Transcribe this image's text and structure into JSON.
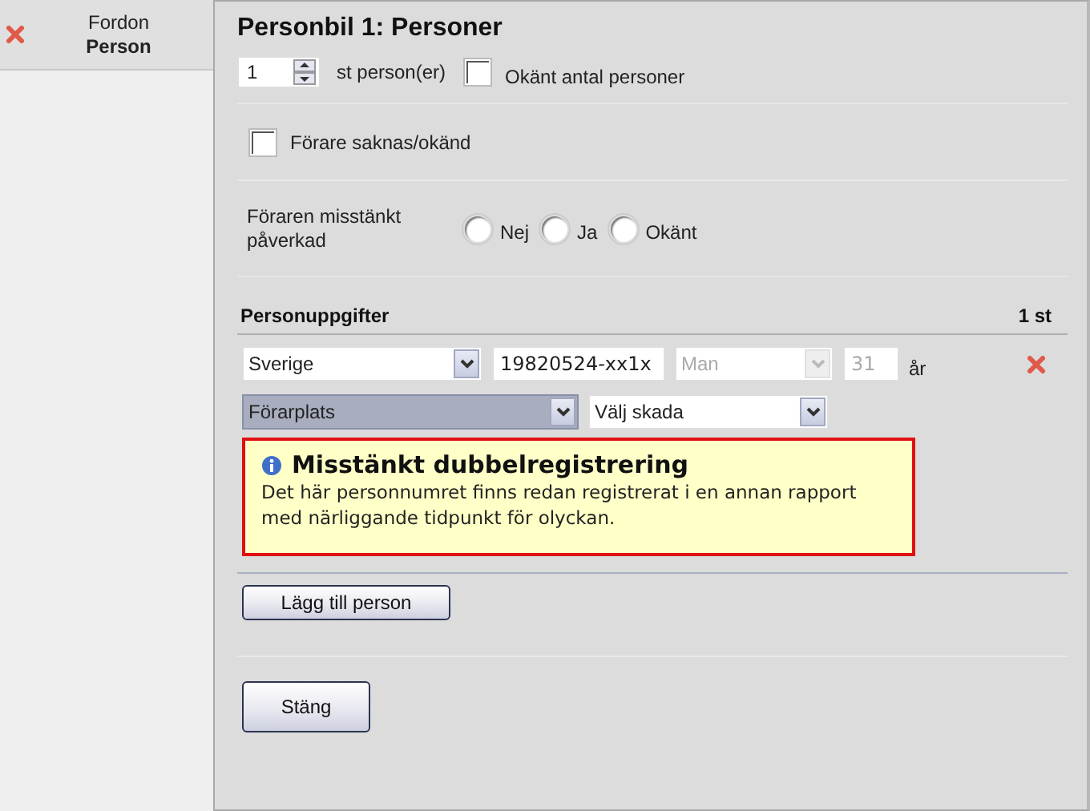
{
  "sidebar": {
    "items": [
      {
        "title": "Fordon",
        "subtitle": "Person",
        "selected": true
      }
    ]
  },
  "title": "Personbil 1: Personer",
  "count": {
    "value": "1",
    "unit": "st person(er)",
    "unknown": {
      "label": "Okänt antal personer",
      "checked": false
    }
  },
  "driver_missing": {
    "label": "Förare saknas/okänd",
    "checked": false
  },
  "influence": {
    "label": "Föraren misstänkt påverkad",
    "options": [
      {
        "label": "Nej",
        "selected": false
      },
      {
        "label": "Ja",
        "selected": false
      },
      {
        "label": "Okänt",
        "selected": false
      }
    ]
  },
  "persons": {
    "title": "Personuppgifter",
    "count": "1 st",
    "rows": [
      {
        "country": "Sverige",
        "id_number": "19820524-xx1x",
        "gender": {
          "value": "Man",
          "disabled": true
        },
        "age": {
          "value": "31",
          "disabled": true
        },
        "age_unit": "år",
        "seat": {
          "value": "Förarplats",
          "focused": true
        },
        "injury": "Välj skada"
      }
    ]
  },
  "alert": {
    "title": "Misstänkt dubbelregistrering",
    "text": "Det här personnumret finns redan registrerat i en annan rapport med närliggande tidpunkt för olyckan."
  },
  "add_button": "Lägg till person",
  "close_button": "Stäng"
}
